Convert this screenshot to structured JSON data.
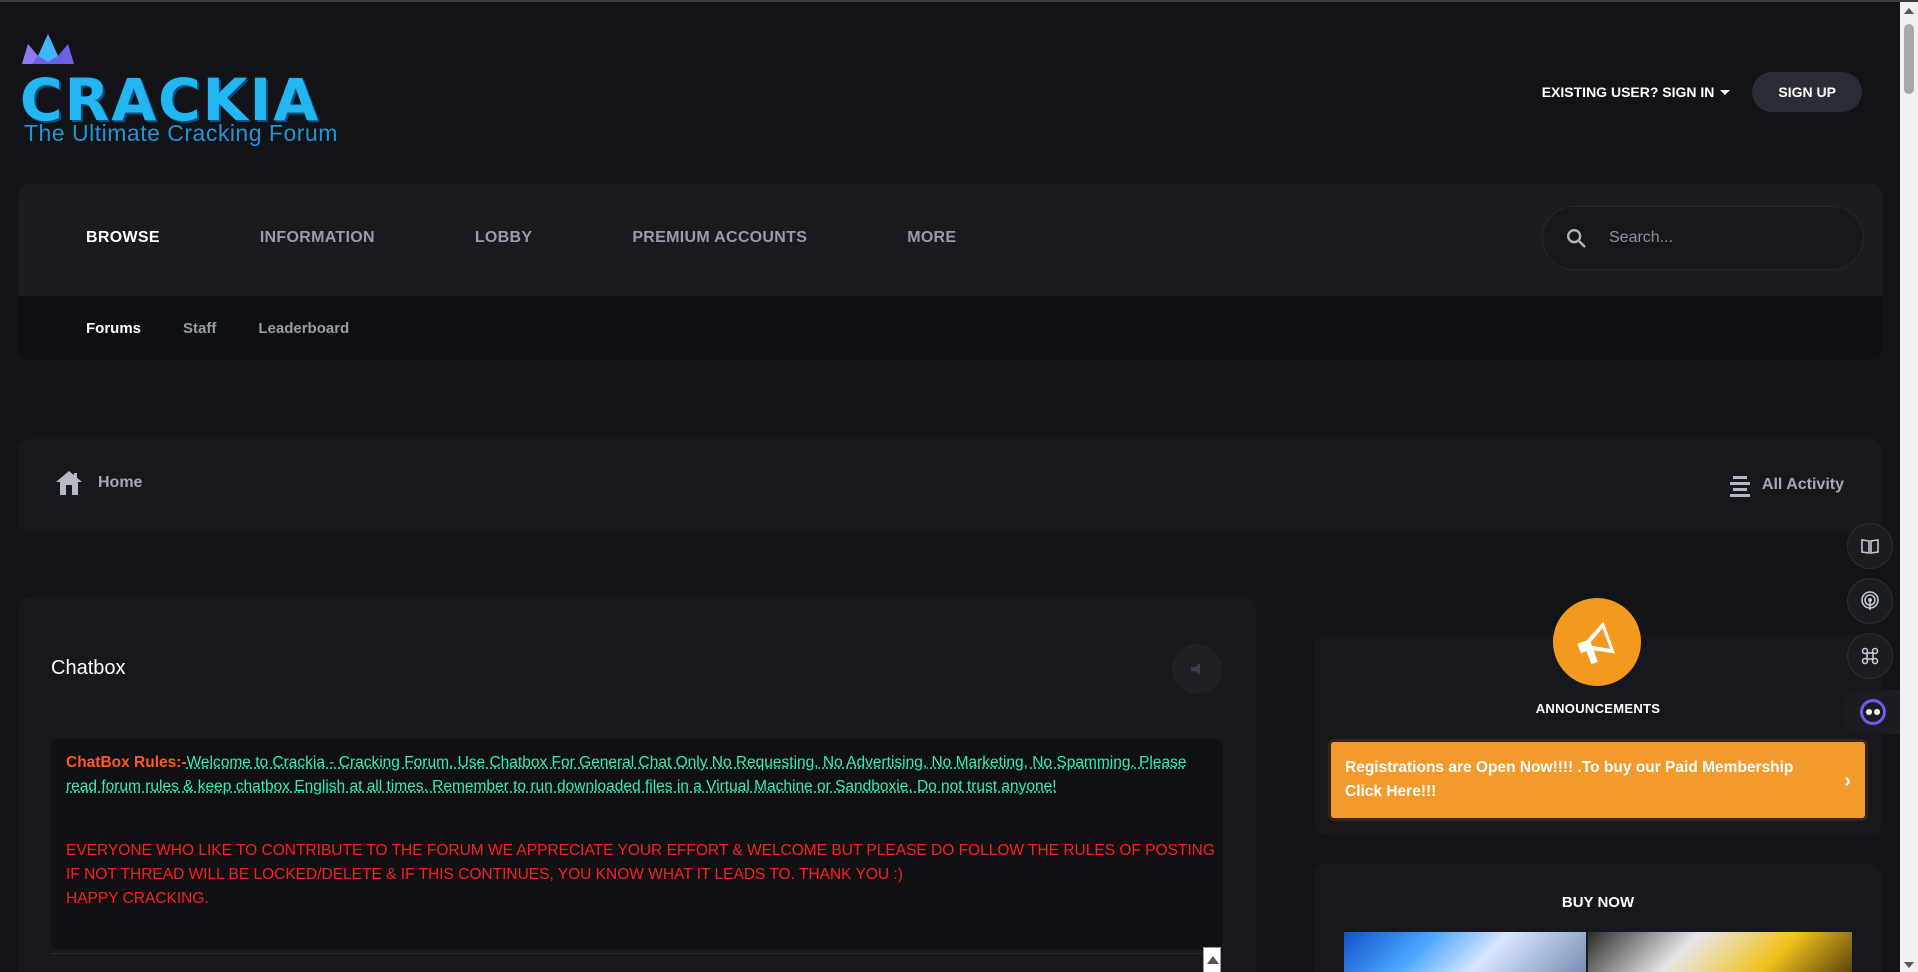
{
  "brand": {
    "name": "CRACKIA",
    "tagline": "The Ultimate Cracking Forum",
    "primary_color": "#22b7f0"
  },
  "auth": {
    "signin_label": "EXISTING USER? SIGN IN",
    "signup_label": "SIGN UP"
  },
  "nav": {
    "items": [
      {
        "label": "BROWSE",
        "active": true
      },
      {
        "label": "INFORMATION",
        "active": false
      },
      {
        "label": "LOBBY",
        "active": false
      },
      {
        "label": "PREMIUM ACCOUNTS",
        "active": false
      },
      {
        "label": "MORE",
        "active": false
      }
    ],
    "search_placeholder": "Search...",
    "sub_items": [
      {
        "label": "Forums",
        "active": true
      },
      {
        "label": "Staff",
        "active": false
      },
      {
        "label": "Leaderboard",
        "active": false
      }
    ]
  },
  "breadcrumb": {
    "home_label": "Home",
    "activity_label": "All Activity"
  },
  "chatbox": {
    "title": "Chatbox",
    "rules_label": "ChatBox Rules:-",
    "rules_text": "Welcome to Crackia - Cracking Forum. Use Chatbox For General Chat Only No Requesting, No Advertising, No Marketing, No Spamming. Please read forum rules & keep chatbox English at all times. Remember to run downloaded files in a Virtual Machine or Sandboxie. Do not trust anyone!",
    "warning_line1": "EVERYONE WHO LIKE TO CONTRIBUTE TO THE FORUM WE APPRECIATE YOUR EFFORT & WELCOME BUT PLEASE DO FOLLOW THE RULES OF POSTING IF NOT THREAD WILL BE LOCKED/DELETE & IF THIS CONTINUES, YOU KNOW WHAT IT LEADS TO. THANK YOU :)",
    "warning_line2": "HAPPY CRACKING.",
    "rules_label_color": "#ff5a1f",
    "rules_text_color": "#2ef0b6",
    "warning_color": "#ff1f1f"
  },
  "announcements": {
    "title": "ANNOUNCEMENTS",
    "item": "Registrations are Open Now!!!! .To buy our Paid Membership Click Here!!!",
    "accent_color": "#f39a1e"
  },
  "buy_now": {
    "title": "BUY NOW"
  },
  "side_buttons": [
    "book-icon",
    "broadcast-icon",
    "command-icon",
    "bot-icon"
  ]
}
